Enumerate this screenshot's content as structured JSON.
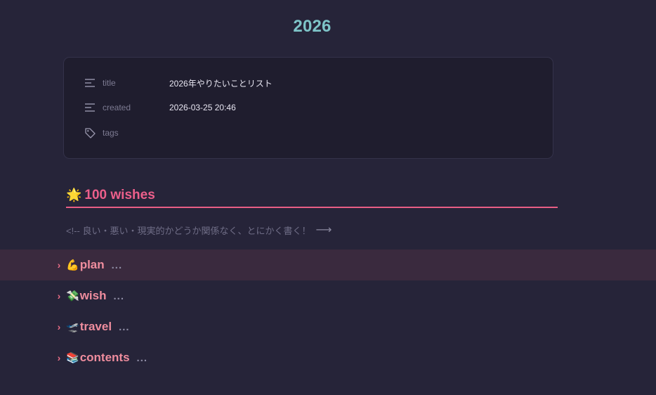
{
  "document": {
    "title": "2026"
  },
  "properties": {
    "rows": [
      {
        "icon": "text-lines-icon",
        "key": "title",
        "value": "2026年やりたいことリスト"
      },
      {
        "icon": "text-lines-icon",
        "key": "created",
        "value": "2026-03-25 20:46"
      },
      {
        "icon": "tag-icon",
        "key": "tags",
        "value": ""
      }
    ]
  },
  "heading": {
    "emoji": "🌟",
    "text": "100 wishes",
    "color": "#ec5f8b"
  },
  "comment": {
    "text": "<!-- 良い・悪い・現実的かどうか関係なく、とにかく書く！",
    "arrow": "⟶"
  },
  "sections": [
    {
      "emoji": "💪",
      "label": "plan",
      "collapsed_indicator": "...",
      "active": true
    },
    {
      "emoji": "💸",
      "label": "wish",
      "collapsed_indicator": "...",
      "active": false
    },
    {
      "emoji": "🛫",
      "label": "travel",
      "collapsed_indicator": "...",
      "active": false
    },
    {
      "emoji": "📚",
      "label": "contents",
      "collapsed_indicator": "...",
      "active": false
    }
  ],
  "colors": {
    "background": "#262439",
    "title": "#7ec4c8",
    "accent": "#e85d85",
    "section_label": "#ef8d9e"
  }
}
